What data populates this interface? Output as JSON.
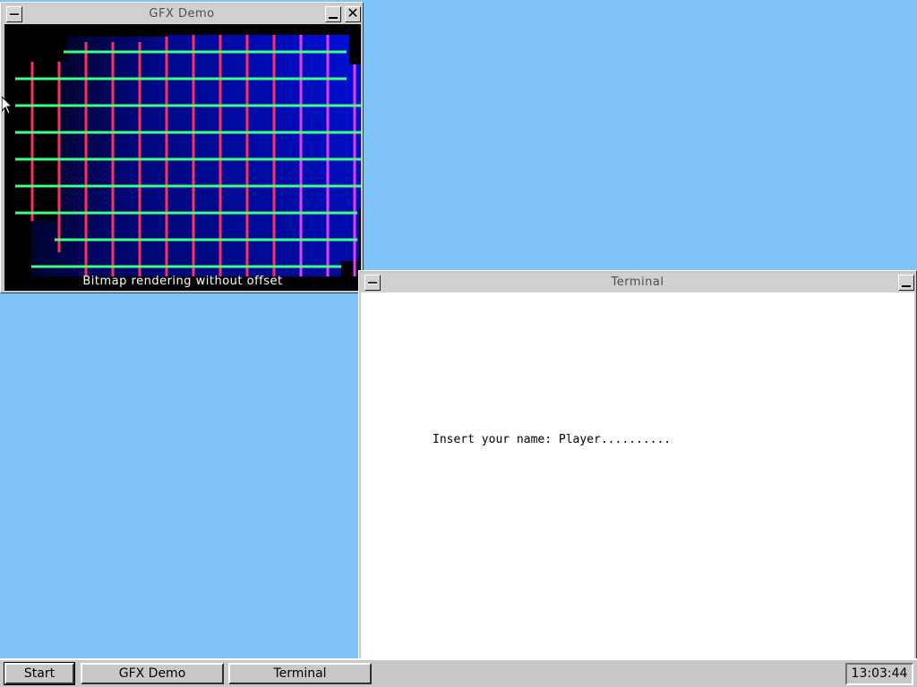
{
  "desktop": {
    "background": "#80c4fc"
  },
  "gfx_window": {
    "title": "GFX Demo",
    "caption": "Bitmap rendering without offset",
    "icons": {
      "system_menu": "dash-icon",
      "minimize": "minimize-icon",
      "close": "close-x-icon"
    }
  },
  "terminal_window": {
    "title": "Terminal",
    "prompt": "Insert your name: Player.........."
  },
  "taskbar": {
    "start_label": "Start",
    "tasks": [
      "GFX Demo",
      "Terminal"
    ],
    "clock": "13:03:44"
  },
  "colors": {
    "grid_vertical": "#ff3060",
    "grid_horizontal": "#40ff80",
    "grid_background": "#0010c0"
  }
}
